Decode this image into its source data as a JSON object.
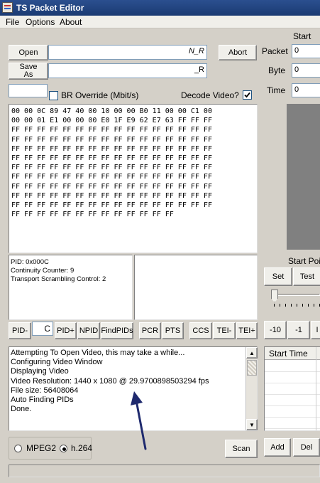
{
  "window": {
    "title": "TS Packet Editor"
  },
  "menu": [
    "File",
    "Options",
    "About"
  ],
  "file_row": {
    "open_label": "Open",
    "open_path": "N_R",
    "abort_label": "Abort",
    "save_label": "Save As",
    "save_path": "_R"
  },
  "options_row": {
    "br_override_label": "BR Override (Mbit/s)",
    "br_override_checked": false,
    "decode_video_label": "Decode Video?",
    "decode_video_checked": true
  },
  "hex_lines": [
    "00 00 0C 89 47 40 00 10 00 00 B0 11 00 00 C1 00",
    "00 00 01 E1 00 00 00 E0 1F E9 62 E7 63 FF FF FF",
    "FF FF FF FF FF FF FF FF FF FF FF FF FF FF FF FF",
    "FF FF FF FF FF FF FF FF FF FF FF FF FF FF FF FF",
    "FF FF FF FF FF FF FF FF FF FF FF FF FF FF FF FF",
    "FF FF FF FF FF FF FF FF FF FF FF FF FF FF FF FF",
    "FF FF FF FF FF FF FF FF FF FF FF FF FF FF FF FF",
    "FF FF FF FF FF FF FF FF FF FF FF FF FF FF FF FF",
    "FF FF FF FF FF FF FF FF FF FF FF FF FF FF FF FF",
    "FF FF FF FF FF FF FF FF FF FF FF FF FF FF FF FF",
    "FF FF FF FF FF FF FF FF FF FF FF FF FF FF FF FF",
    "FF FF FF FF FF FF FF FF FF FF FF FF FF"
  ],
  "packet_info": {
    "pid": "PID: 0x000C",
    "continuity": "Continuity Counter: 9",
    "scrambling": "Transport Scrambling Control: 2"
  },
  "pid_buttons": {
    "pid_minus": "PID-",
    "pid_value": "C",
    "pid_plus": "PID+",
    "npid": "NPID",
    "findpids": "FindPIDs",
    "pcr": "PCR",
    "pts": "PTS",
    "ccs": "CCS",
    "tei_minus": "TEI-",
    "tei_plus": "TEI+"
  },
  "log_lines": [
    "Attempting To Open Video, this may take a while...",
    "Configuring Video Window",
    "Displaying Video",
    "Video Resolution: 1440 x 1080 @ 29.9700898503294 fps",
    "File size: 56408064",
    "Auto Finding PIDs",
    "Done."
  ],
  "codec": {
    "mpeg2_label": "MPEG2",
    "h264_label": "h.264",
    "selected": "h.264",
    "scan_label": "Scan"
  },
  "right_panel": {
    "start_header": "Start",
    "packet_label": "Packet",
    "packet_value": "0",
    "byte_label": "Byte",
    "byte_value": "0",
    "time_label": "Time",
    "time_value": "0",
    "start_point_label": "Start Poi",
    "set_label": "Set",
    "test_label": "Test",
    "minus10_label": "-10",
    "minus1_label": "-1",
    "next_label": "I",
    "start_time_header": "Start Time",
    "add_label": "Add",
    "del_label": "Del"
  },
  "colors": {
    "annotation_arrow": "#1f2a6e",
    "video_area": "#808080"
  }
}
